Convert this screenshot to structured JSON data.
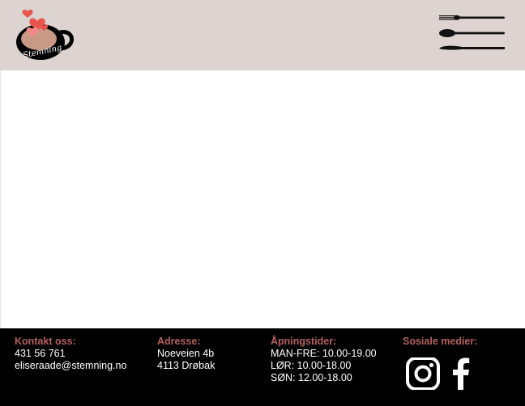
{
  "header": {
    "logo_text": "Stemning",
    "logo_colors": {
      "heart": "#e8554f",
      "heart_light": "#f08a86",
      "cup": "#c89a86",
      "outline": "#000000"
    },
    "menu_icon": "cutlery-menu-icon",
    "background": "#ddd4d2"
  },
  "footer": {
    "background": "#000000",
    "heading_color": "#b5615f",
    "contact": {
      "heading": "Kontakt oss:",
      "phone": "431 56 761",
      "email": "eliseraade@stemning.no"
    },
    "address": {
      "heading": "Adresse:",
      "street": "Noeveien 4b",
      "city": "4113 Drøbak"
    },
    "hours": {
      "heading": "Åpningstider:",
      "weekdays": "MAN-FRE: 10.00-19.00",
      "saturday": "LØR: 10.00-18.00",
      "sunday": "SØN: 12.00-18.00"
    },
    "social": {
      "heading": "Sosiale medier:",
      "icons": [
        "instagram-icon",
        "facebook-icon"
      ]
    }
  }
}
